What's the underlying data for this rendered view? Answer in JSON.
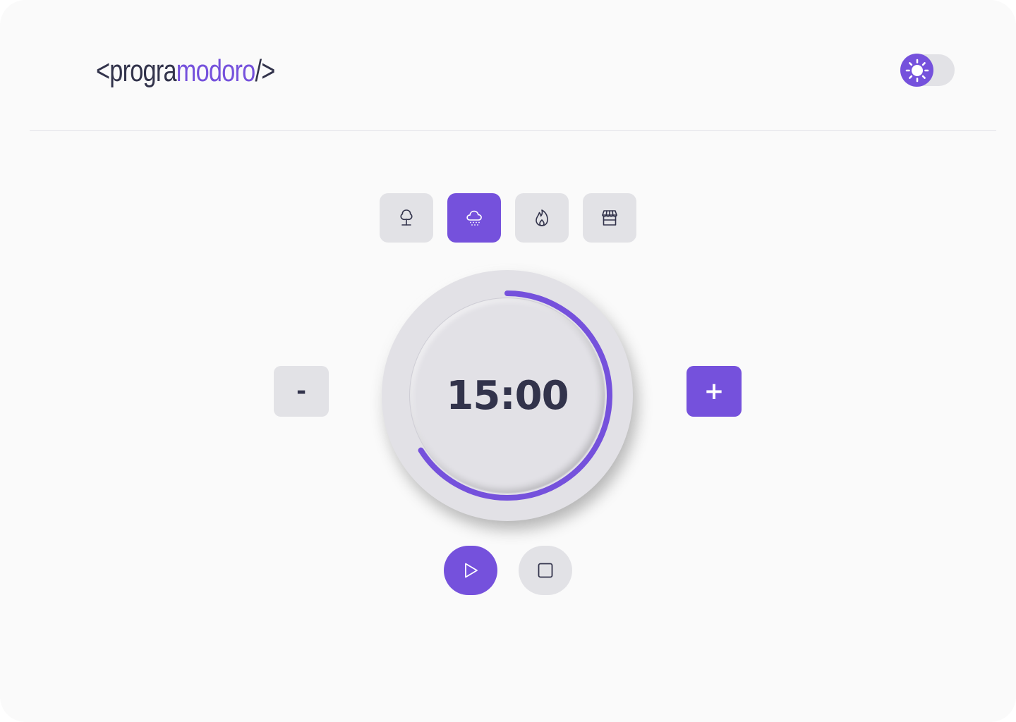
{
  "header": {
    "logo": {
      "open": "<progra",
      "accent": "modoro",
      "close": "/>"
    },
    "theme_toggle": {
      "icon": "sun-icon",
      "state": "light"
    }
  },
  "sound_tabs": [
    {
      "icon": "tree-icon",
      "active": false
    },
    {
      "icon": "rain-cloud-icon",
      "active": true
    },
    {
      "icon": "fire-icon",
      "active": false
    },
    {
      "icon": "store-icon",
      "active": false
    }
  ],
  "timer": {
    "display": "15:00",
    "progress": 0.66,
    "decrease_label": "-",
    "increase_label": "+"
  },
  "controls": {
    "play_icon": "play-icon",
    "stop_icon": "stop-icon"
  },
  "colors": {
    "accent": "#7551dc",
    "text_dark": "#32334b",
    "surface": "#e2e2e6",
    "background": "#fafafa"
  }
}
